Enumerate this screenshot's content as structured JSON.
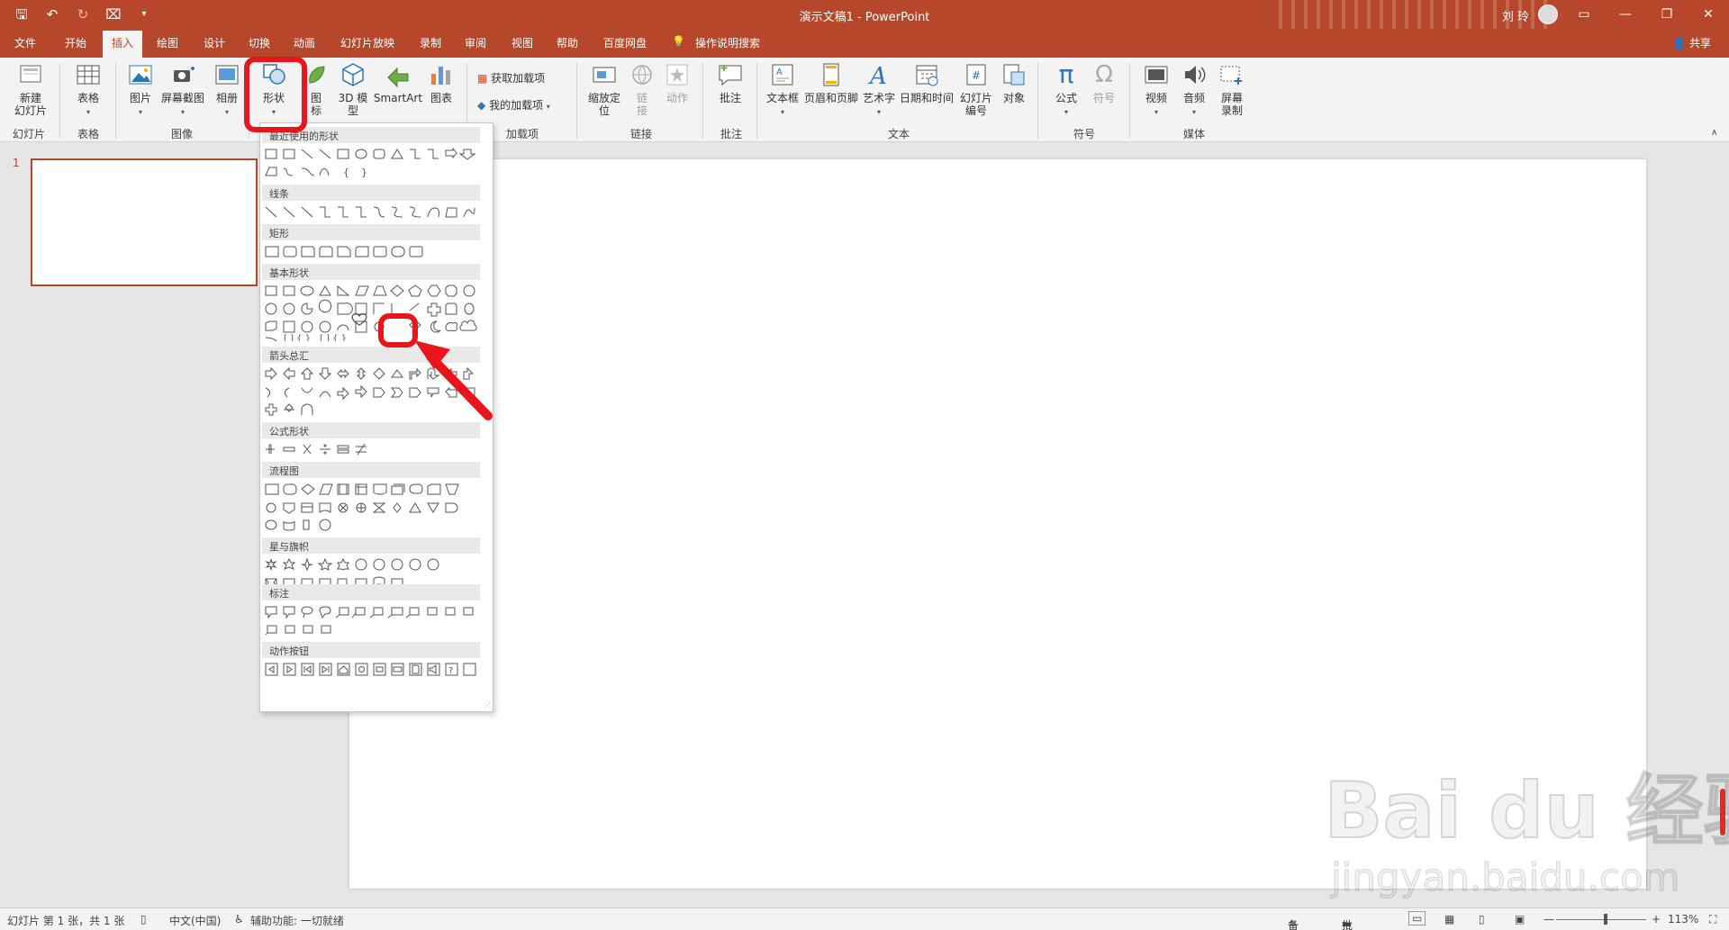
{
  "titlebar": {
    "title": "演示文稿1  -  PowerPoint",
    "user_name": "刘 玲",
    "qat_icons": [
      "save-icon",
      "undo-icon",
      "redo-icon",
      "present-icon",
      "customize-icon"
    ]
  },
  "tabs": {
    "items": [
      "文件",
      "开始",
      "插入",
      "绘图",
      "设计",
      "切换",
      "动画",
      "幻灯片放映",
      "录制",
      "审阅",
      "视图",
      "帮助",
      "百度网盘"
    ],
    "active": "插入",
    "search": "操作说明搜索",
    "share": "共享"
  },
  "ribbon": {
    "new_slide": "新建\n幻灯片",
    "table": "表格",
    "picture": "图片",
    "screenshot": "屏幕截图",
    "album": "相册",
    "shapes": "形状",
    "icons": "图\n标",
    "model3d": "3D 模\n型",
    "smartart": "SmartArt",
    "chart": "图表",
    "get_addins": "获取加载项",
    "my_addins": "我的加载项",
    "zoom": "缩放定\n位",
    "link": "链\n接",
    "action": "动作",
    "comment": "批注",
    "textbox": "文本框",
    "header_footer": "页眉和页脚",
    "wordart": "艺术字",
    "datetime": "日期和时间",
    "slide_number": "幻灯片\n编号",
    "object": "对象",
    "equation": "公式",
    "symbol": "符号",
    "video": "视频",
    "audio": "音频",
    "screen_record": "屏幕\n录制",
    "groups": {
      "slides": "幻灯片",
      "tables": "表格",
      "images": "图像",
      "addins": "加载项",
      "links": "链接",
      "comments": "批注",
      "text": "文本",
      "symbols": "符号",
      "media": "媒体"
    }
  },
  "thumbnail": {
    "number": "1"
  },
  "shapes_panel": {
    "sections": [
      "最近使用的形状",
      "线条",
      "矩形",
      "基本形状",
      "箭头总汇",
      "公式形状",
      "流程图",
      "星与旗帜",
      "标注",
      "动作按钮"
    ]
  },
  "statusbar": {
    "slide_info": "幻灯片 第 1 张，共 1 张",
    "language": "中文(中国)",
    "accessibility": "辅助功能: 一切就绪",
    "notes": "备注",
    "comments": "批注",
    "zoom_level": "113%"
  },
  "watermark": {
    "main": "Bai  du 经验",
    "sub": "jingyan.baidu.com"
  },
  "colors": {
    "accent": "#b7472a",
    "annotation": "#e8151b"
  }
}
